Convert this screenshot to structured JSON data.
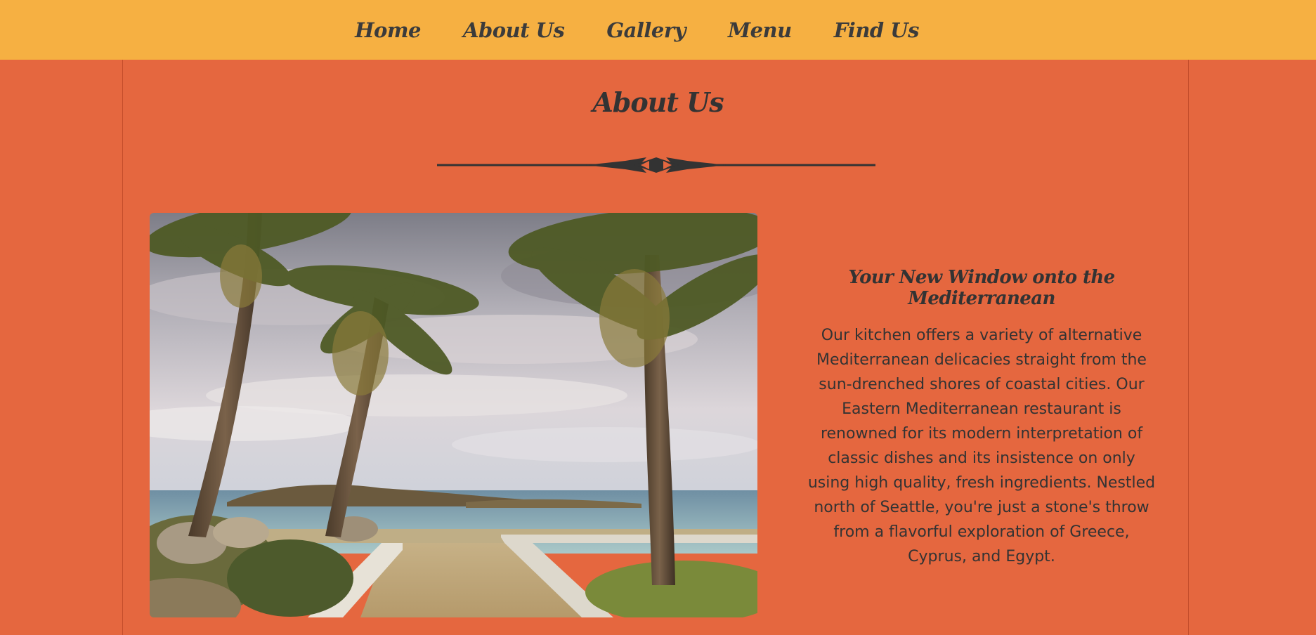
{
  "nav": {
    "items": [
      {
        "label": "Home"
      },
      {
        "label": "About Us"
      },
      {
        "label": "Gallery"
      },
      {
        "label": "Menu"
      },
      {
        "label": "Find Us"
      }
    ]
  },
  "main": {
    "title": "About Us",
    "image": {
      "subject": "palm trees on a beach path by the Mediterranean sea"
    },
    "aside": {
      "heading": "Your New Window onto the Mediterranean",
      "body": "Our kitchen offers a variety of alternative Mediterranean delicacies straight from the sun-drenched shores of coastal cities. Our Eastern Mediterranean restaurant is renowned for its modern interpretation of classic dishes and its insistence on only using high quality, fresh ingredients. Nestled north of Seattle, you're just a stone's throw from a flavorful exploration of Greece, Cyprus, and Egypt."
    }
  },
  "colors": {
    "nav_bg": "#f6b042",
    "page_bg": "#e5673f",
    "text": "#333333"
  },
  "icons": {
    "divider": "ornamental-divider-icon"
  }
}
